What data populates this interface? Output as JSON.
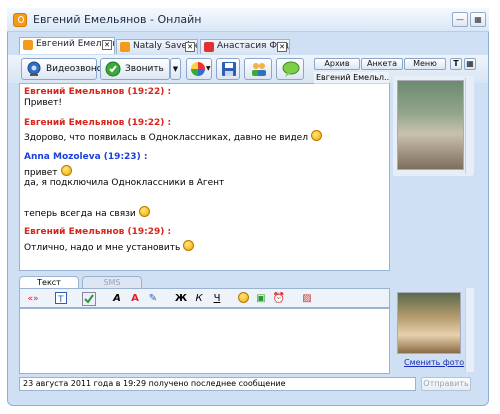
{
  "window": {
    "title": "Евгений Емельянов - Онлайн"
  },
  "tabs": [
    {
      "label": "Евгений Емельянов",
      "active": true
    },
    {
      "label": "Nataly Savelyeva",
      "active": false
    },
    {
      "label": "Анастасия Федина",
      "active": false
    }
  ],
  "toolbar": {
    "video_label": "Видеозвонок",
    "call_label": "Звонить",
    "archive_label": "Архив",
    "profile_label": "Анкета",
    "menu_label": "Меню"
  },
  "contact_name_short": "Евгений Емельл...",
  "messages": [
    {
      "author": "Евгений Емельянов (19:22) :",
      "color": "red",
      "lines": [
        "Привет!"
      ]
    },
    {
      "author": "Евгений Емельянов (19:22) :",
      "color": "red",
      "lines": [
        "Здорово, что появилась в Одноклассниках, давно не видел"
      ]
    },
    {
      "author": "Anna Mozoleva (19:23) :",
      "color": "blue",
      "lines": [
        "привет",
        "да, я подключила Одноклассники в Агент",
        "теперь всегда на связи"
      ]
    },
    {
      "author": "Евгений Емельянов (19:29) :",
      "color": "red",
      "lines": [
        "Отлично, надо и мне установить"
      ]
    }
  ],
  "input_tabs": {
    "text_label": "Текст",
    "sms_label": "SMS"
  },
  "format": {
    "quote": "«»",
    "bold": "Ж",
    "italic": "К",
    "underline": "Ч"
  },
  "change_photo_label": "Сменить фото",
  "status_text": "23 августа 2011 года в 19:29 получено последнее сообщение",
  "send_label": "Отправить"
}
